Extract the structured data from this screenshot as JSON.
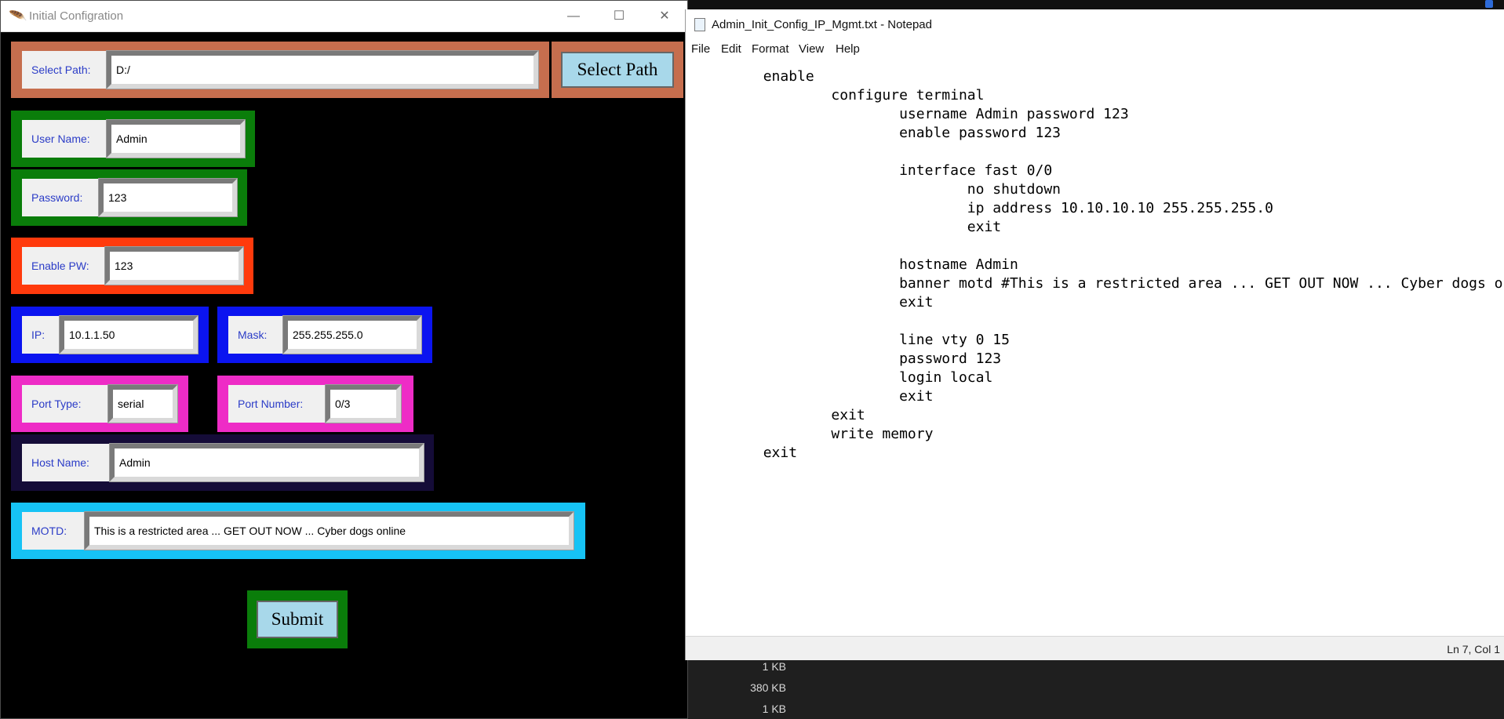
{
  "tk_window": {
    "title": "Initial Configration",
    "controls": {
      "minimize": "—",
      "maximize": "☐",
      "close": "✕"
    },
    "fields": {
      "select_path": {
        "label": "Select Path:",
        "value": "D:/"
      },
      "user_name": {
        "label": "User Name:",
        "value": "Admin"
      },
      "password": {
        "label": "Password:",
        "value": "123"
      },
      "enable_pw": {
        "label": "Enable PW:",
        "value": "123"
      },
      "ip": {
        "label": "IP:",
        "value": "10.1.1.50"
      },
      "mask": {
        "label": "Mask:",
        "value": "255.255.255.0"
      },
      "port_type": {
        "label": "Port Type:",
        "value": "serial"
      },
      "port_number": {
        "label": "Port Number:",
        "value": "0/3"
      },
      "host_name": {
        "label": "Host Name:",
        "value": "Admin"
      },
      "motd": {
        "label": "MOTD:",
        "value": "This is a restricted area ... GET OUT NOW ... Cyber dogs online"
      }
    },
    "buttons": {
      "select_path": "Select Path",
      "submit": "Submit"
    },
    "colors": {
      "path_frame": "#c66e4e",
      "user_frame": "#0a7d0a",
      "enable_frame": "#ff3a0c",
      "ip_frame": "#0b14f0",
      "port_frame": "#ee2cc6",
      "host_frame": "#150c38",
      "motd_frame": "#16c3f5",
      "submit_frame": "#0a7d0a",
      "button_fill": "#a8d8ea",
      "label_text": "#2b3cc7"
    }
  },
  "notepad": {
    "title": "Admin_Init_Config_IP_Mgmt.txt - Notepad",
    "menu": [
      "File",
      "Edit",
      "Format",
      "View",
      "Help"
    ],
    "content": "\tenable\n\t\tconfigure terminal\n\t\t\tusername Admin password 123\n\t\t\tenable password 123\n\n\t\t\tinterface fast 0/0\n\t\t\t\tno shutdown\n\t\t\t\tip address 10.10.10.10 255.255.255.0\n\t\t\t\texit\n\n\t\t\thostname Admin\n\t\t\tbanner motd #This is a restricted area ... GET OUT NOW ... Cyber dogs online#\n\t\t\texit\n\n\t\t\tline vty 0 15\n\t\t\tpassword 123\n\t\t\tlogin local\n\t\t\texit\n\t\texit\n\t\twrite memory\n\texit",
    "status_position": "Ln 7, Col 1"
  },
  "background_list": {
    "sizes": [
      "1 KB",
      "380 KB",
      "1 KB"
    ]
  }
}
